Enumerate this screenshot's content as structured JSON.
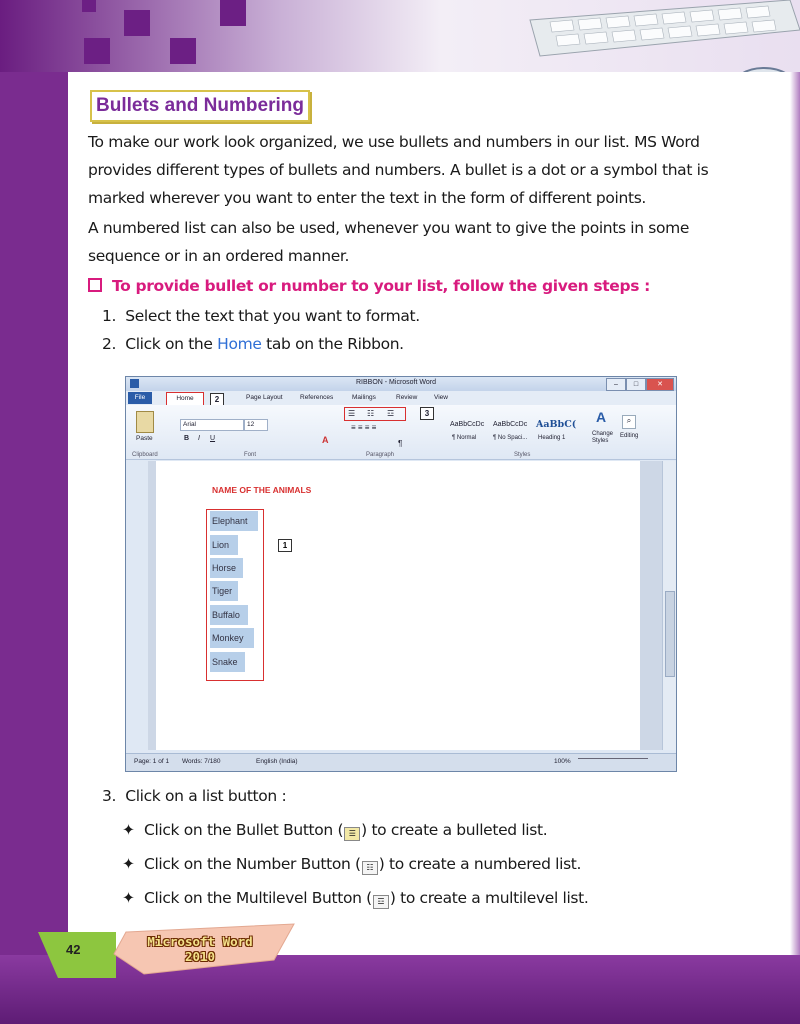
{
  "heading": "Bullets and Numbering",
  "paragraphs": [
    "To make our work look organized, we use bullets and numbers in our list. MS Word provides different types of bullets and numbers. A bullet is a dot or a symbol that is marked wherever you want to enter the text in the form of different points.",
    "A numbered list can also be used, whenever you want to give the points in some sequence or in an ordered manner."
  ],
  "tip": "To provide bullet or number to your list, follow the given steps :",
  "steps": {
    "s1_num": "1.",
    "s1": "Select the text that you want to format.",
    "s2_num": "2.",
    "s2_a": "Click on the ",
    "s2_home": "Home",
    "s2_b": " tab on the Ribbon.",
    "s3_num": "3.",
    "s3": "Click on a list button :"
  },
  "bullets": {
    "b1_a": "Click on the Bullet Button (",
    "b1_b": ") to create a bulleted list.",
    "b2_a": "Click on the Number Button (",
    "b2_b": ") to create a numbered list.",
    "b3_a": "Click on the Multilevel Button (",
    "b3_b": ") to create a multilevel list."
  },
  "word": {
    "title": "RIBBON - Microsoft Word",
    "tabs": [
      "File",
      "Home",
      "Page Layout",
      "References",
      "Mailings",
      "Review",
      "View"
    ],
    "font_name": "Arial",
    "font_size": "12",
    "groups": [
      "Clipboard",
      "Font",
      "Paragraph",
      "Styles"
    ],
    "paste": "Paste",
    "styles": [
      "AaBbCcDc",
      "AaBbCcDc",
      "AaBbC("
    ],
    "style_names": [
      "¶ Normal",
      "¶ No Spaci...",
      "Heading 1"
    ],
    "change_styles": "Change Styles",
    "editing": "Editing",
    "doc_title": "NAME OF THE ANIMALS",
    "animals": [
      "Elephant",
      "Lion",
      "Horse",
      "Tiger",
      "Buffalo",
      "Monkey",
      "Snake"
    ],
    "status": {
      "page": "Page: 1 of 1",
      "words": "Words: 7/180",
      "lang": "English (India)",
      "zoom": "100%"
    },
    "callouts": [
      "1",
      "2",
      "3"
    ]
  },
  "footer": {
    "page_number": "42",
    "book_title_1": "Microsoft Word",
    "book_title_2": "2010"
  },
  "colors": {
    "heading": "#7b2c9a",
    "tip": "#d81b7e",
    "home_link": "#2f6fd6",
    "highlight": "#d83030"
  }
}
